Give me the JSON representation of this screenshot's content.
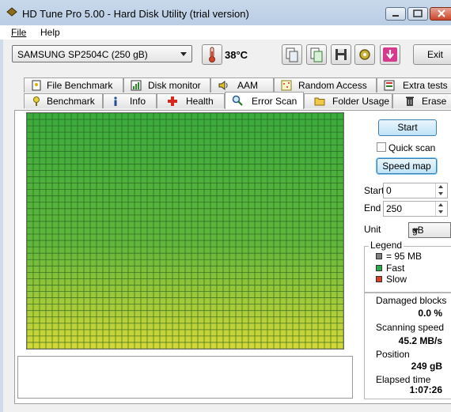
{
  "window": {
    "title": "HD Tune Pro 5.00 - Hard Disk Utility (trial version)"
  },
  "menu": {
    "file": "File",
    "help": "Help"
  },
  "toolbar": {
    "drive": "SAMSUNG SP2504C (250 gB)",
    "temperature": "38°C",
    "exit": "Exit",
    "icons": [
      "copy-icon",
      "copy-info-icon",
      "save-icon",
      "settings-icon",
      "download-icon"
    ]
  },
  "tabs_top": [
    {
      "label": "File Benchmark",
      "icon": "file-benchmark-icon"
    },
    {
      "label": "Disk monitor",
      "icon": "disk-monitor-icon"
    },
    {
      "label": "AAM",
      "icon": "speaker-icon"
    },
    {
      "label": "Random Access",
      "icon": "random-access-icon"
    },
    {
      "label": "Extra tests",
      "icon": "extra-tests-icon"
    }
  ],
  "tabs_bottom": [
    {
      "label": "Benchmark",
      "icon": "benchmark-icon"
    },
    {
      "label": "Info",
      "icon": "info-icon"
    },
    {
      "label": "Health",
      "icon": "health-icon"
    },
    {
      "label": "Error Scan",
      "icon": "magnifier-icon",
      "active": true
    },
    {
      "label": "Folder Usage",
      "icon": "folder-icon"
    },
    {
      "label": "Erase",
      "icon": "trash-icon"
    }
  ],
  "scan": {
    "start_button": "Start",
    "quick_scan": "Quick scan",
    "speed_map": "Speed map",
    "start_label": "Start",
    "start_value": "0",
    "end_label": "End",
    "end_value": "250",
    "unit_label": "Unit",
    "unit_value": "gB",
    "grid_colors": {
      "top": "#3bab3d",
      "bottom": "#d6d838",
      "line": "#1f5a1f"
    }
  },
  "legend": {
    "title": "Legend",
    "block": "= 95 MB",
    "fast": "Fast",
    "slow": "Slow",
    "colors": {
      "block": "#808080",
      "fast": "#2fa84a",
      "slow": "#d4402a"
    }
  },
  "stats": {
    "damaged_label": "Damaged blocks",
    "damaged_value": "0.0 %",
    "speed_label": "Scanning speed",
    "speed_value": "45.2 MB/s",
    "position_label": "Position",
    "position_value": "249 gB",
    "elapsed_label": "Elapsed time",
    "elapsed_value": "1:07:26"
  }
}
